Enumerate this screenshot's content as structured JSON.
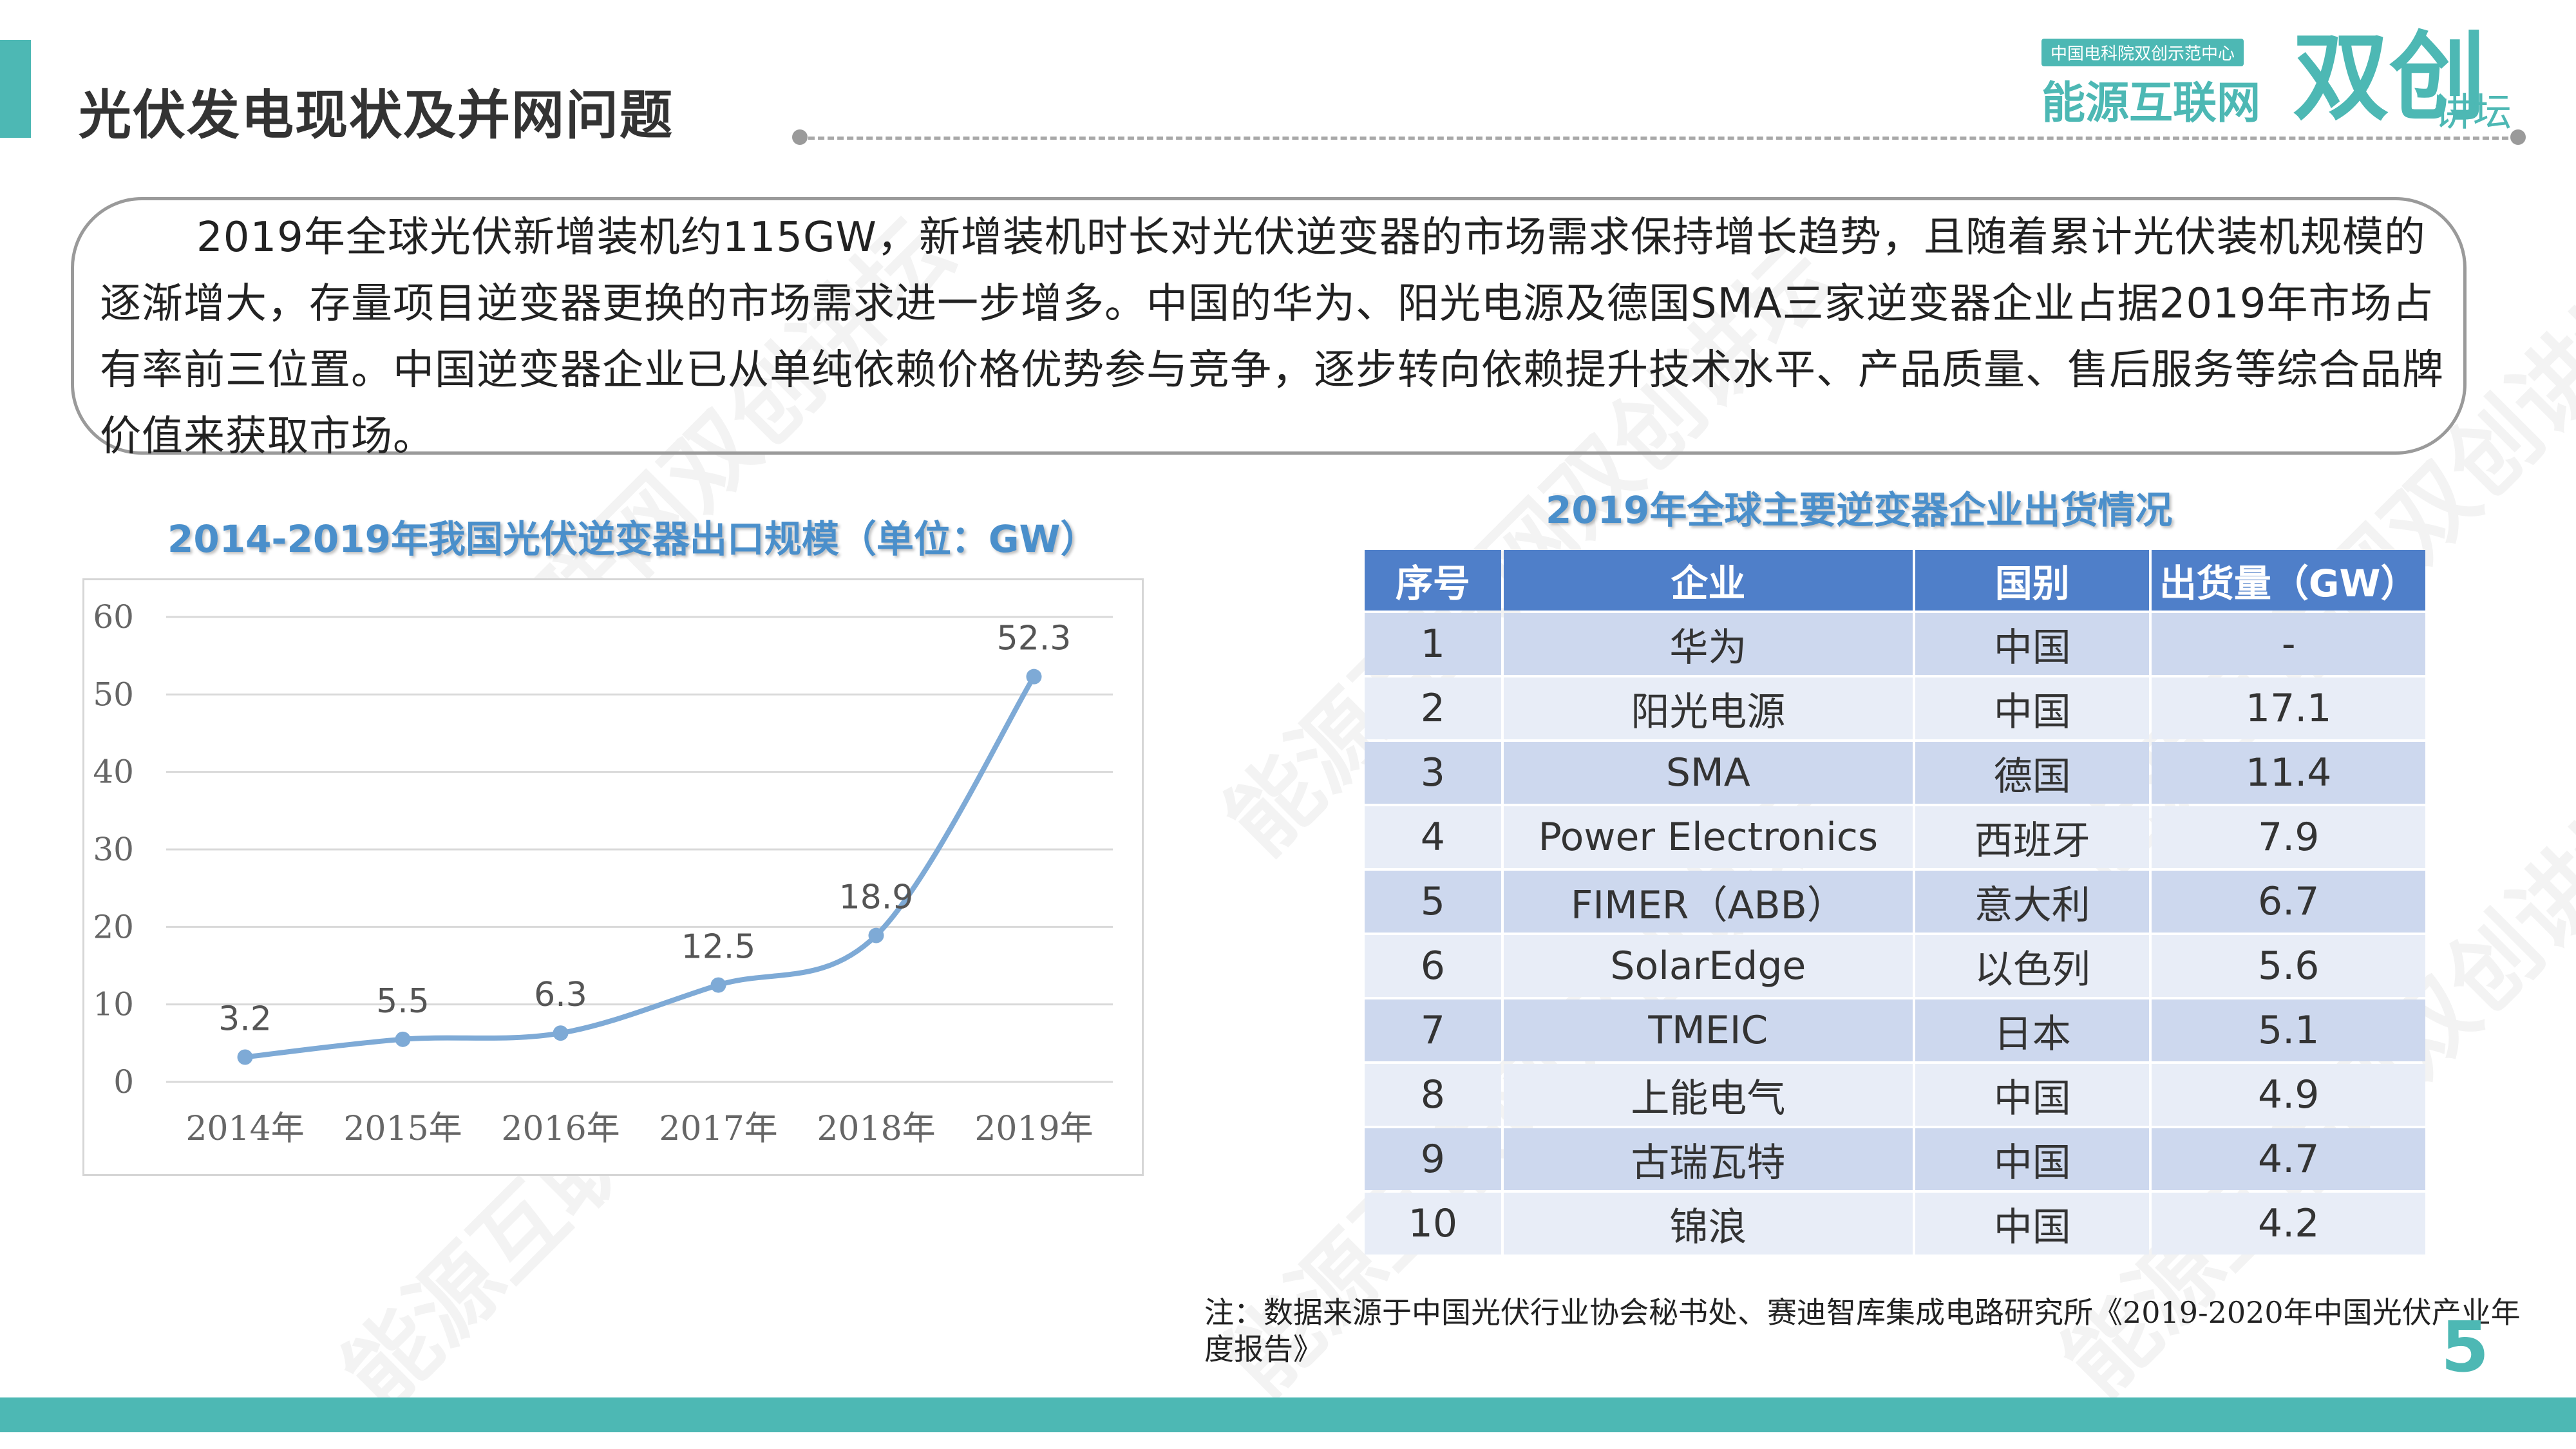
{
  "header": {
    "title": "光伏发电现状及并网问题"
  },
  "logo": {
    "tag": "中国电科院双创示范中心",
    "main": "能源互联网",
    "big": "双创",
    "forum": "讲坛"
  },
  "watermark": "能源互联网双创讲坛",
  "intro": {
    "text": "2019年全球光伏新增装机约115GW，新增装机时长对光伏逆变器的市场需求保持增长趋势，且随着累计光伏装机规模的逐渐增大，存量项目逆变器更换的市场需求进一步增多。中国的华为、阳光电源及德国SMA三家逆变器企业占据2019年市场占有率前三位置。中国逆变器企业已从单纯依赖价格优势参与竞争，逐步转向依赖提升技术水平、产品质量、售后服务等综合品牌价值来获取市场。"
  },
  "chart_data": {
    "type": "line",
    "title": "2014-2019年我国光伏逆变器出口规模（单位：GW）",
    "categories": [
      "2014年",
      "2015年",
      "2016年",
      "2017年",
      "2018年",
      "2019年"
    ],
    "values": [
      3.2,
      5.5,
      6.3,
      12.5,
      18.9,
      52.3
    ],
    "data_labels": [
      "3.2",
      "5.5",
      "6.3",
      "12.5",
      "18.9",
      "52.3"
    ],
    "y_ticks": [
      "0",
      "10",
      "20",
      "30",
      "40",
      "50",
      "60"
    ],
    "ylim": [
      0,
      60
    ],
    "grid": true,
    "legend": "none",
    "line_color": "#7eaad6"
  },
  "table": {
    "title": "2019年全球主要逆变器企业出货情况",
    "headers": [
      "序号",
      "企业",
      "国别",
      "出货量（GW）"
    ],
    "rows": [
      [
        "1",
        "华为",
        "中国",
        "-"
      ],
      [
        "2",
        "阳光电源",
        "中国",
        "17.1"
      ],
      [
        "3",
        "SMA",
        "德国",
        "11.4"
      ],
      [
        "4",
        "Power Electronics",
        "西班牙",
        "7.9"
      ],
      [
        "5",
        "FIMER（ABB）",
        "意大利",
        "6.7"
      ],
      [
        "6",
        "SolarEdge",
        "以色列",
        "5.6"
      ],
      [
        "7",
        "TMEIC",
        "日本",
        "5.1"
      ],
      [
        "8",
        "上能电气",
        "中国",
        "4.9"
      ],
      [
        "9",
        "古瑞瓦特",
        "中国",
        "4.7"
      ],
      [
        "10",
        "锦浪",
        "中国",
        "4.2"
      ]
    ],
    "header_color": "#4f7fc9",
    "row_color_odd": "#cdd8ee",
    "row_color_even": "#e8edf7"
  },
  "footer": {
    "note": "注：数据来源于中国光伏行业协会秘书处、赛迪智库集成电路研究所《2019-2020年中国光伏产业年度报告》",
    "page_number": "5"
  },
  "colors": {
    "accent": "#4db8b4",
    "caption": "#4a8fcb"
  }
}
